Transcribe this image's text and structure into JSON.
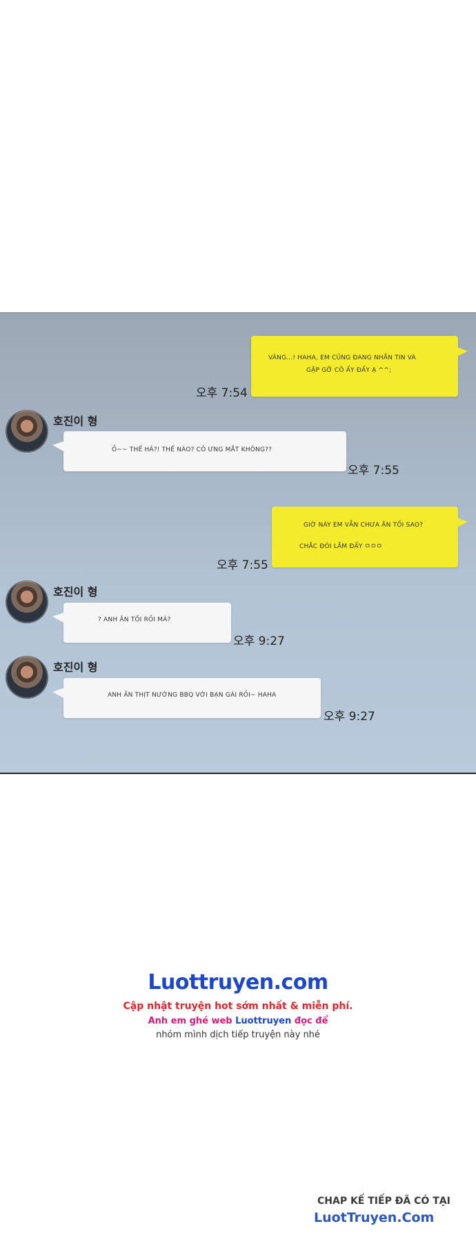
{
  "messages": [
    {
      "sender": "me",
      "lines": [
        "VÂNG...! HAHA, EM CŨNG ĐANG NHẮN TIN VÀ",
        "GẶP GỠ CÔ ẤY ĐẤY Ạ ^^;"
      ],
      "time": "오후 7:54"
    },
    {
      "sender": "other",
      "name": "호진이 형",
      "lines": [
        "Ồ~~ THẾ HẢ?! THẾ NÀO? CÔ ƯNG MẮT KHÔNG??"
      ],
      "time": "오후 7:55"
    },
    {
      "sender": "me",
      "lines": [
        "GIỜ NÀY EM VẪN CHƯA ĂN TỐI SAO?",
        "CHẮC ĐÓI LẮM ĐẤY ㅁㅁㅁ"
      ],
      "time": "오후 7:55"
    },
    {
      "sender": "other",
      "name": "호진이 형",
      "lines": [
        "? ANH ĂN TỐI RỒI MÀ?"
      ],
      "time": "오후 9:27"
    },
    {
      "sender": "other",
      "name": "호진이 형",
      "lines": [
        "ANH ĂN THỊT NƯỚNG BBQ VỚI BẠN GÁI RỒI~ HAHA"
      ],
      "time": "오후 9:27"
    }
  ],
  "footer": {
    "brand": "Luottruyen.com",
    "promo_line1": "Cập nhật truyện hot sớm nhất & miễn phí.",
    "promo_line2_a": "Anh em ghé web ",
    "promo_line2_b": "Luottruyen",
    "promo_line2_c": " đọc để",
    "promo_line3": "nhóm mình dịch tiếp truyện này nhé",
    "next_chapter": "CHAP KẾ TIẾP ĐÃ CÓ TẠI",
    "next_site": "LuotTruyen.Com"
  },
  "colors": {
    "my_bubble": "#f4ec2a",
    "other_bubble": "#f6f6f6",
    "brand_blue": "#1c47c8",
    "promo_red": "#e0252c",
    "promo_pink": "#d81a7a"
  }
}
